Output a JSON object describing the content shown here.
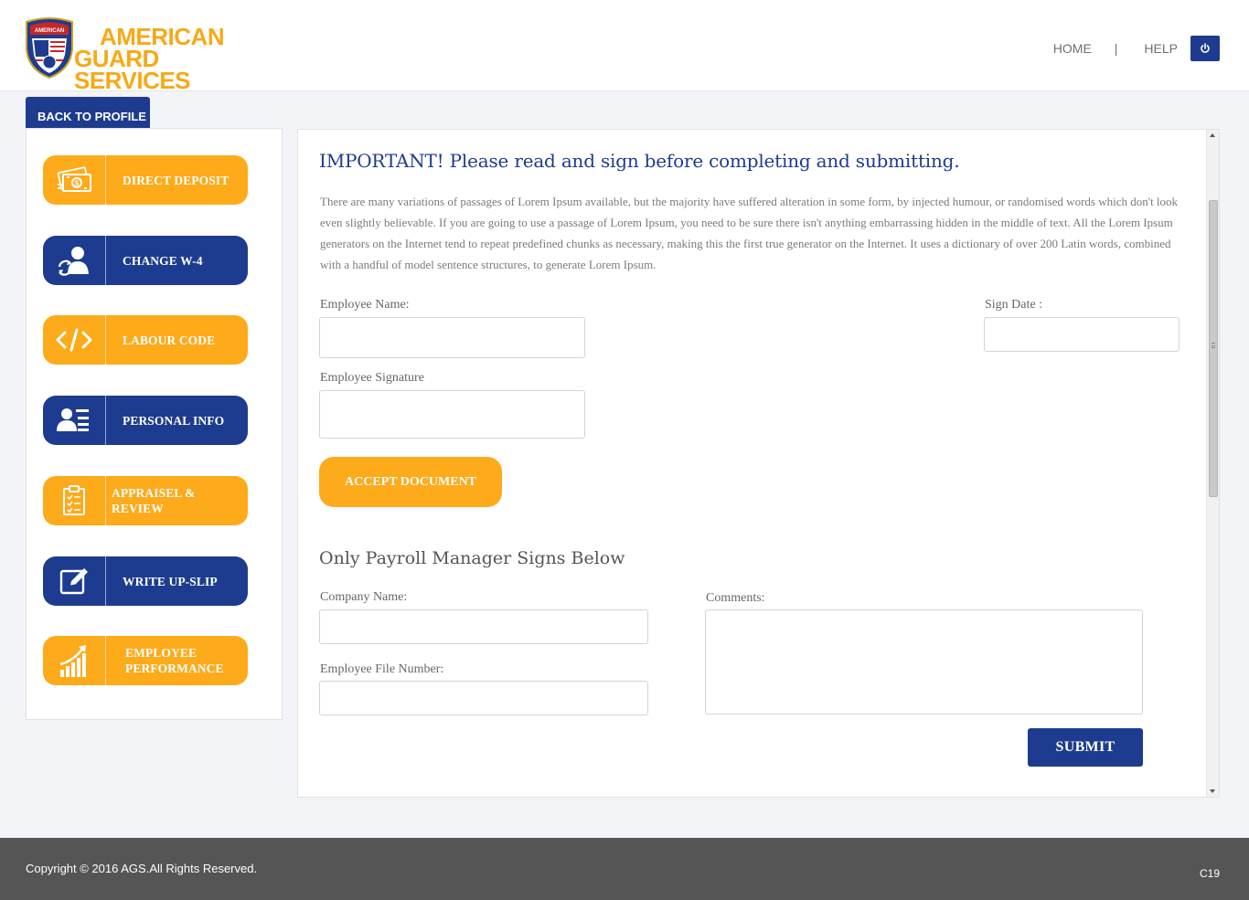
{
  "brand": {
    "line1": "AMERICAN",
    "line2": "GUARD SERVICES",
    "shield_text": "AMERICAN",
    "color": "#f7a917"
  },
  "topnav": {
    "home": "HOME",
    "separator": "|",
    "help": "HELP",
    "power_icon": "power-icon"
  },
  "back_tab": "BACK TO PROFILE",
  "sidebar": {
    "items": [
      {
        "label": "DIRECT DEPOSIT",
        "icon": "money-icon",
        "color": "#fdaa1b"
      },
      {
        "label": "CHANGE W-4",
        "icon": "user-refresh-icon",
        "color": "#1d3c8f"
      },
      {
        "label": "LABOUR CODE",
        "icon": "code-icon",
        "color": "#fdaa1b"
      },
      {
        "label": "PERSONAL INFO",
        "icon": "user-card-icon",
        "color": "#1d3c8f"
      },
      {
        "label": "APPRAISEL & REVIEW",
        "icon": "clipboard-checklist-icon",
        "color": "#fdaa1b"
      },
      {
        "label": "WRITE UP-SLIP",
        "icon": "edit-icon",
        "color": "#1d3c8f"
      },
      {
        "label_line1": "EMPLOYEE",
        "label_line2": "PERFORMANCE",
        "icon": "growth-chart-icon",
        "color": "#fdaa1b"
      }
    ]
  },
  "main": {
    "title": "IMPORTANT! Please read and sign before completing and submitting.",
    "paragraph": "There are many variations of passages of Lorem Ipsum available, but the majority have suffered alteration in some form, by injected humour, or randomised words which don't look even slightly believable. If you are going to use a passage of Lorem Ipsum, you need to be sure there isn't anything embarrassing hidden in the middle of text. All the Lorem Ipsum generators on the Internet tend to repeat predefined chunks as necessary, making this the first true generator on the Internet. It uses a dictionary of over 200 Latin words, combined with a handful of model sentence structures, to generate Lorem Ipsum.",
    "employee_name_label": "Employee Name:",
    "employee_name_value": "",
    "sign_date_label": "Sign Date  :",
    "sign_date_value": "",
    "employee_signature_label": "Employee Signature",
    "employee_signature_value": "",
    "accept_button": "ACCEPT DOCUMENT",
    "payroll_title": "Only Payroll Manager Signs Below",
    "company_name_label": "Company Name:",
    "company_name_value": "",
    "comments_label": "Comments:",
    "comments_value": "",
    "file_number_label": "Employee File Number:",
    "file_number_value": "",
    "submit_button": "SUBMIT"
  },
  "footer": {
    "copyright": "Copyright © 2016  AGS.All Rights Reserved.",
    "code": "C19"
  },
  "colors": {
    "primary_blue": "#1d3c8f",
    "accent_orange": "#fdaa1b",
    "footer_gray": "#555555"
  }
}
